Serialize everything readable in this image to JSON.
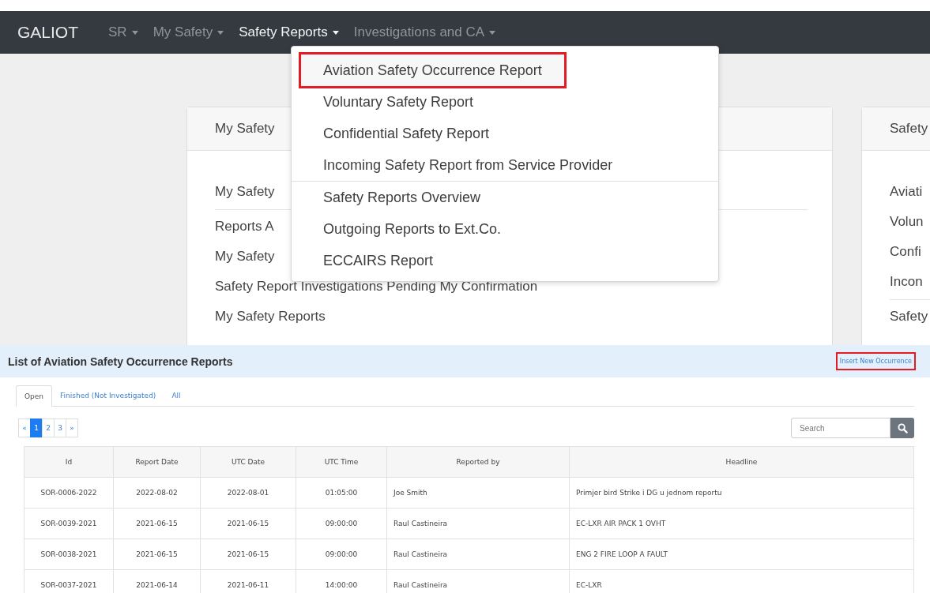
{
  "navbar": {
    "brand": "GALIOT",
    "menus": [
      {
        "label": "SR",
        "selected": false
      },
      {
        "label": "My Safety",
        "selected": false
      },
      {
        "label": "Safety Reports",
        "selected": true
      },
      {
        "label": "Investigations and CA",
        "selected": false
      }
    ]
  },
  "dropdown": {
    "groups": [
      [
        {
          "label": "Aviation Safety Occurrence Report",
          "highlighted": true
        },
        {
          "label": "Voluntary Safety Report",
          "highlighted": false
        },
        {
          "label": "Confidential Safety Report",
          "highlighted": false
        },
        {
          "label": "Incoming Safety Report from Service Provider",
          "highlighted": false
        }
      ],
      [
        {
          "label": "Safety Reports Overview",
          "highlighted": false
        },
        {
          "label": "Outgoing Reports to Ext.Co.",
          "highlighted": false
        },
        {
          "label": "ECCAIRS Report",
          "highlighted": false
        }
      ]
    ]
  },
  "cards": [
    {
      "title": "My Safety",
      "items": [
        "My Safety",
        "Reports A",
        "My Safety",
        "Safety Report Investigations Pending My Confirmation",
        "My Safety Reports"
      ]
    },
    {
      "title": "Safety",
      "items": [
        "Aviati",
        "Volun",
        "Confi",
        "Incon",
        "Safety"
      ]
    }
  ],
  "list": {
    "title": "List of Aviation Safety Occurrence Reports",
    "insert_button": {
      "label": "Insert New Occurrence",
      "highlighted": true
    },
    "tabs": [
      {
        "label": "Open",
        "selected": true
      },
      {
        "label": "Finished (Not Investigated)",
        "selected": false
      },
      {
        "label": "All",
        "selected": false
      }
    ],
    "pagination": {
      "prev": "«",
      "pages": [
        {
          "label": "1",
          "selected": true
        },
        {
          "label": "2",
          "selected": false
        },
        {
          "label": "3",
          "selected": false
        }
      ],
      "next": "»"
    },
    "search": {
      "placeholder": "Search"
    },
    "table": {
      "columns": [
        "Id",
        "Report Date",
        "UTC Date",
        "UTC Time",
        "Reported by",
        "Headline"
      ],
      "rows": [
        [
          "SOR-0006-2022",
          "2022-08-02",
          "2022-08-01",
          "01:05:00",
          "Joe Smith",
          "Primjer bird Strike i DG u jednom reportu"
        ],
        [
          "SOR-0039-2021",
          "2021-06-15",
          "2021-06-15",
          "09:00:00",
          "Raul Castineira",
          "EC-LXR AIR PACK 1 OVHT"
        ],
        [
          "SOR-0038-2021",
          "2021-06-15",
          "2021-06-15",
          "09:00:00",
          "Raul Castineira",
          "ENG 2 FIRE LOOP A FAULT"
        ],
        [
          "SOR-0037-2021",
          "2021-06-14",
          "2021-06-11",
          "14:00:00",
          "Raul Castineira",
          "EC-LXR"
        ]
      ]
    }
  }
}
